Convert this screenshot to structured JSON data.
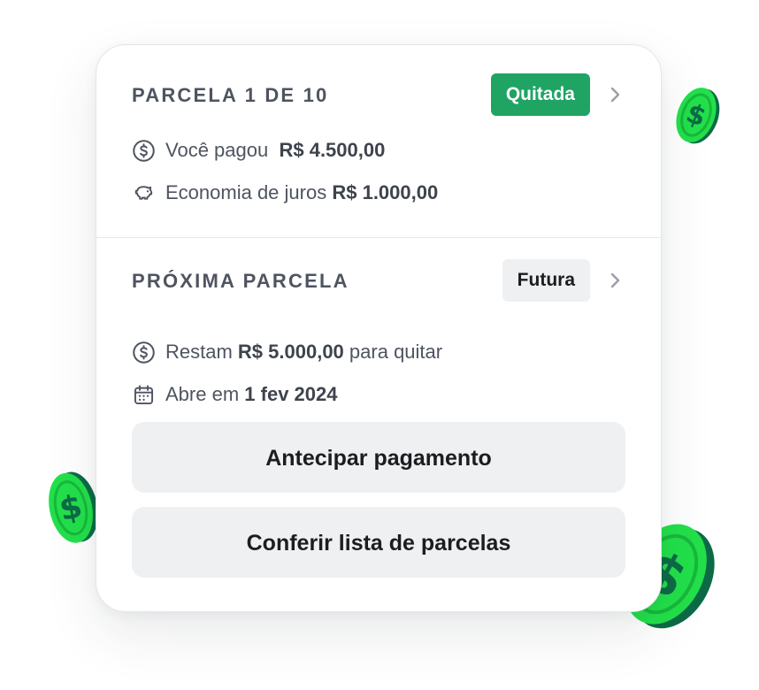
{
  "installment": {
    "title": "PARCELA 1 DE 10",
    "status": "Quitada",
    "paid_label": "Você pagou",
    "paid_value": "R$ 4.500,00",
    "savings_label": "Economia de juros",
    "savings_value": "R$ 1.000,00"
  },
  "next": {
    "title": "PRÓXIMA PARCELA",
    "status": "Futura",
    "remaining_label": "Restam",
    "remaining_value": "R$ 5.000,00",
    "remaining_suffix": "para quitar",
    "opens_label": "Abre em",
    "opens_value": "1 fev 2024"
  },
  "actions": {
    "anticipate": "Antecipar pagamento",
    "list": "Conferir lista de parcelas"
  },
  "colors": {
    "paid_badge": "#1fa464",
    "future_badge": "#eef0f2",
    "coin_green": "#22e04a",
    "coin_dark": "#0c6b46"
  },
  "icons": [
    "dollar-circle-icon",
    "piggy-bank-icon",
    "calendar-icon",
    "chevron-right-icon",
    "coin-icon"
  ]
}
